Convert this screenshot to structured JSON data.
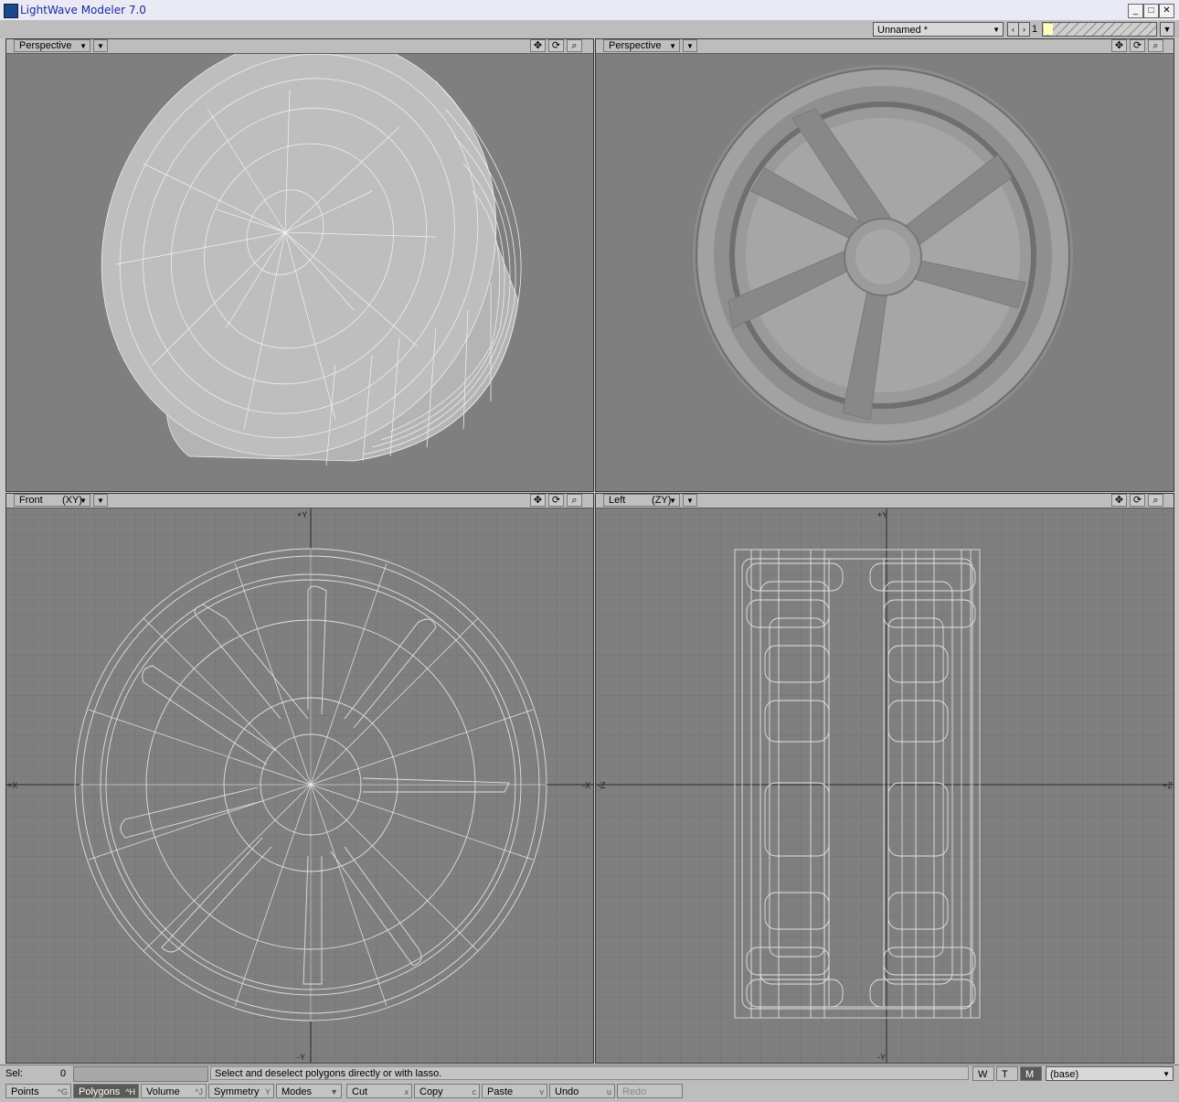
{
  "window": {
    "title": "LightWave Modeler 7.0"
  },
  "topbar": {
    "object_name": "Unnamed *",
    "layer_number": "1"
  },
  "viewports": [
    {
      "view_label": "Perspective",
      "axis_label": ""
    },
    {
      "view_label": "Perspective",
      "axis_label": ""
    },
    {
      "view_label": "Front",
      "axis_label": "(XY)"
    },
    {
      "view_label": "Left",
      "axis_label": "(ZY)"
    }
  ],
  "axes": {
    "front": {
      "top": "+Y",
      "bottom": "-Y",
      "left": "+X",
      "right": "-X"
    },
    "left": {
      "top": "+Y",
      "bottom": "-Y",
      "left": "-Z",
      "right": "+Z"
    }
  },
  "status": {
    "sel_label": "Sel:",
    "sel_value": "0",
    "message": "Select and deselect polygons directly or with lasso.",
    "wtm": [
      "W",
      "T",
      "M"
    ],
    "layer_dropdown": "(base)"
  },
  "toolbar": [
    {
      "label": "Points",
      "shortcut": "^G",
      "state": "normal"
    },
    {
      "label": "Polygons",
      "shortcut": "^H",
      "state": "active"
    },
    {
      "label": "Volume",
      "shortcut": "^J",
      "state": "normal"
    },
    {
      "label": "Symmetry",
      "shortcut": "Y",
      "state": "normal"
    },
    {
      "label": "Modes",
      "shortcut": "",
      "state": "normal"
    },
    {
      "label": "Cut",
      "shortcut": "x",
      "state": "normal"
    },
    {
      "label": "Copy",
      "shortcut": "c",
      "state": "normal"
    },
    {
      "label": "Paste",
      "shortcut": "v",
      "state": "normal"
    },
    {
      "label": "Undo",
      "shortcut": "u",
      "state": "normal"
    },
    {
      "label": "Redo",
      "shortcut": "",
      "state": "disabled"
    }
  ],
  "icons": {
    "move": "move-icon",
    "rotate": "rotate-icon",
    "zoom": "zoom-icon"
  },
  "colors": {
    "viewport_bg": "#7f7f7f",
    "wire": "#e6e6e6",
    "grid": "#717171",
    "panel": "#bdbdbd",
    "title_text": "#1a2a9a"
  }
}
